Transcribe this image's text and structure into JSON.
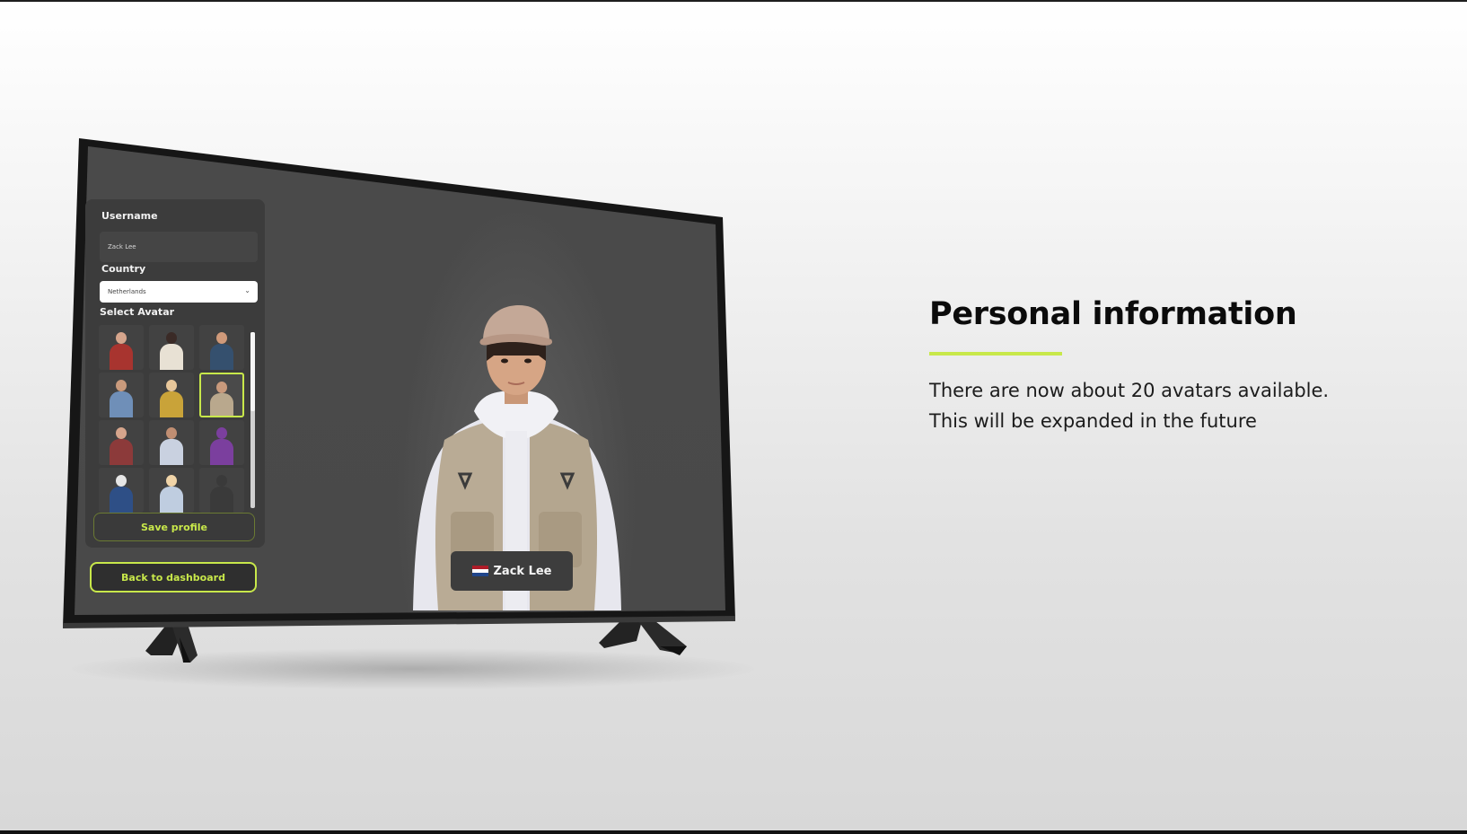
{
  "profile_panel": {
    "username_label": "Username",
    "username_value": "Zack Lee",
    "country_label": "Country",
    "country_value": "Netherlands",
    "select_avatar_label": "Select Avatar",
    "save_button": "Save profile",
    "back_button": "Back to dashboard"
  },
  "avatars": [
    {
      "name": "avatar-1",
      "body": "#a8342f",
      "head": "#d6a58c"
    },
    {
      "name": "avatar-2",
      "body": "#e8e1d4",
      "head": "#3a2a26"
    },
    {
      "name": "avatar-3",
      "body": "#35506e",
      "head": "#d09a7a"
    },
    {
      "name": "avatar-4",
      "body": "#6f8fb8",
      "head": "#c99a7c"
    },
    {
      "name": "avatar-5",
      "body": "#c9a339",
      "head": "#e8c79b"
    },
    {
      "name": "avatar-6",
      "body": "#b9a88d",
      "head": "#c99a7c",
      "selected": true
    },
    {
      "name": "avatar-7",
      "body": "#8c3a3a",
      "head": "#d6a58c"
    },
    {
      "name": "avatar-8",
      "body": "#c9d1e0",
      "head": "#c08e72"
    },
    {
      "name": "avatar-9",
      "body": "#7b3f9e",
      "head": "#7b3f9e"
    },
    {
      "name": "avatar-10",
      "body": "#2e4f86",
      "head": "#e6e6e6"
    },
    {
      "name": "avatar-11",
      "body": "#bfcde0",
      "head": "#f0d4a8"
    },
    {
      "name": "avatar-12",
      "body": "#3a3a3a",
      "head": "#3a3a3a"
    }
  ],
  "preview": {
    "player_name": "Zack Lee",
    "flag_colors": [
      "#ae1c28",
      "#ffffff",
      "#21468b"
    ]
  },
  "info": {
    "title": "Personal information",
    "line1": "There are now about 20 avatars available.",
    "line2": "This will be expanded in the future"
  },
  "colors": {
    "accent": "#c8e84a",
    "panel": "#3c3c3c",
    "screen": "#4a4a4a"
  }
}
